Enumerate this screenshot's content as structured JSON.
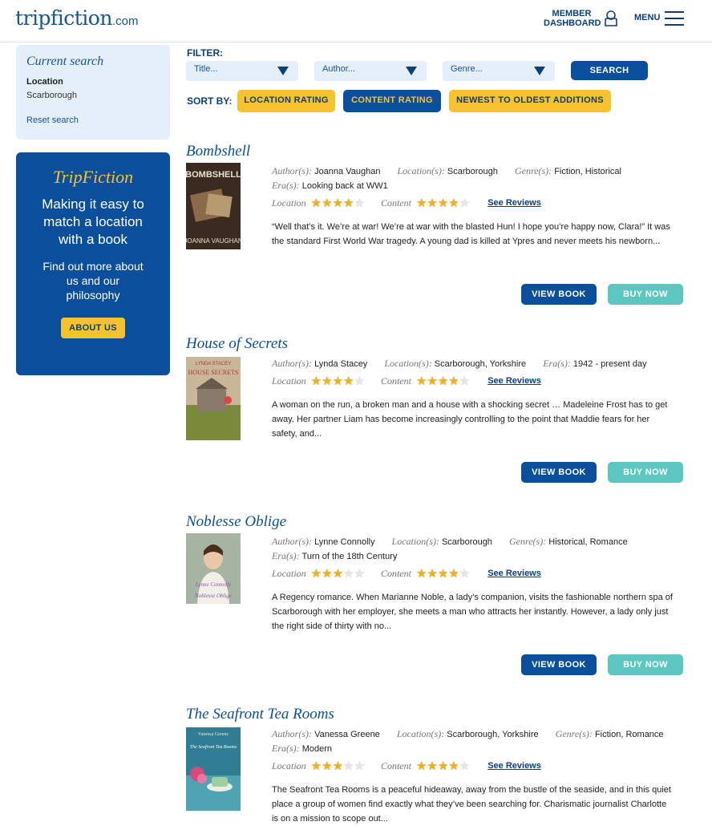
{
  "header": {
    "logo_main": "tripfiction",
    "logo_suffix": ".com",
    "member_line1": "MEMBER",
    "member_line2": "DASHBOARD",
    "menu_label": "MENU"
  },
  "sidebar": {
    "current_search_title": "Current search",
    "location_label": "Location",
    "location_value": "Scarborough",
    "reset_label": "Reset search",
    "promo_title": "TripFiction",
    "promo_main": "Making it easy to match a location with a book",
    "promo_sub": "Find out more about us and our philosophy",
    "promo_button": "ABOUT US"
  },
  "filters": {
    "label": "FILTER:",
    "title_placeholder": "Title...",
    "author_placeholder": "Author...",
    "genre_placeholder": "Genre...",
    "search_button": "SEARCH"
  },
  "sort": {
    "label": "SORT BY:",
    "location_rating": "LOCATION RATING",
    "content_rating": "CONTENT RATING",
    "newest": "NEWEST TO OLDEST ADDITIONS"
  },
  "labels": {
    "authors": "Author(s):",
    "locations": "Location(s):",
    "genres": "Genre(s):",
    "era": "Era(s):",
    "location_rating": "Location",
    "content_rating": "Content",
    "see_reviews": "See Reviews",
    "view_book": "VIEW BOOK",
    "buy_now": "BUY NOW"
  },
  "colors": {
    "brand_blue": "#0b4f9c",
    "accent_yellow": "#f6c22d",
    "buy_teal": "#5cc7c0"
  },
  "books": [
    {
      "title": "Bombshell",
      "author": "Joanna Vaughan",
      "location": "Scarborough",
      "genre": "Fiction, Historical",
      "era": "Looking back at WW1",
      "location_stars": 4,
      "content_stars": 4,
      "description": "“Well that’s it. We’re at war! We’re at war with the blasted Hun! I hope you’re happy now, Clara!” It was the standard First World War tragedy. A young dad is killed at Ypres and never meets his newborn...",
      "cover_top": "BOMBSHELL",
      "cover_bottom": "JOANNA VAUGHAN"
    },
    {
      "title": "House of Secrets",
      "author": "Lynda Stacey",
      "location": "Scarborough, Yorkshire",
      "genre": "",
      "era": "1942 - present day",
      "location_stars": 4,
      "content_stars": 4,
      "description": "A woman on the run, a broken man and a house with a shocking secret … Madeleine Frost has to get away. Her partner Liam has become increasingly controlling to the point that Maddie fears for her safety, and...",
      "cover_top": "LYNDA STACEY",
      "cover_bottom": "HOUSE SECRETS"
    },
    {
      "title": "Noblesse Oblige",
      "author": "Lynne Connolly",
      "location": "Scarborough",
      "genre": "Historical, Romance",
      "era": "Turn of the 18th Century",
      "location_stars": 3,
      "content_stars": 4,
      "description": "A Regency romance. When Marianne Noble, a lady’s companion, visits the fashionable northern spa of Scarborough with her employer, she meets a man who attracts her instantly. However, a lady only just the right side of thirty with no...",
      "cover_top": "Lynne Connolly",
      "cover_bottom": "Noblesse Oblige"
    },
    {
      "title": "The Seafront Tea Rooms",
      "author": "Vanessa Greene",
      "location": "Scarborough, Yorkshire",
      "genre": "Fiction, Romance",
      "era": "Modern",
      "location_stars": 3,
      "content_stars": 4,
      "description": "The Seafront Tea Rooms is a peaceful hideaway, away from the bustle of the seaside, and in this quiet place a group of women find exactly what they’ve been searching for. Charismatic journalist Charlotte is on a mission to scope out...",
      "cover_top": "Vanessa Greene",
      "cover_bottom": "The Seafront Tea Rooms"
    }
  ]
}
